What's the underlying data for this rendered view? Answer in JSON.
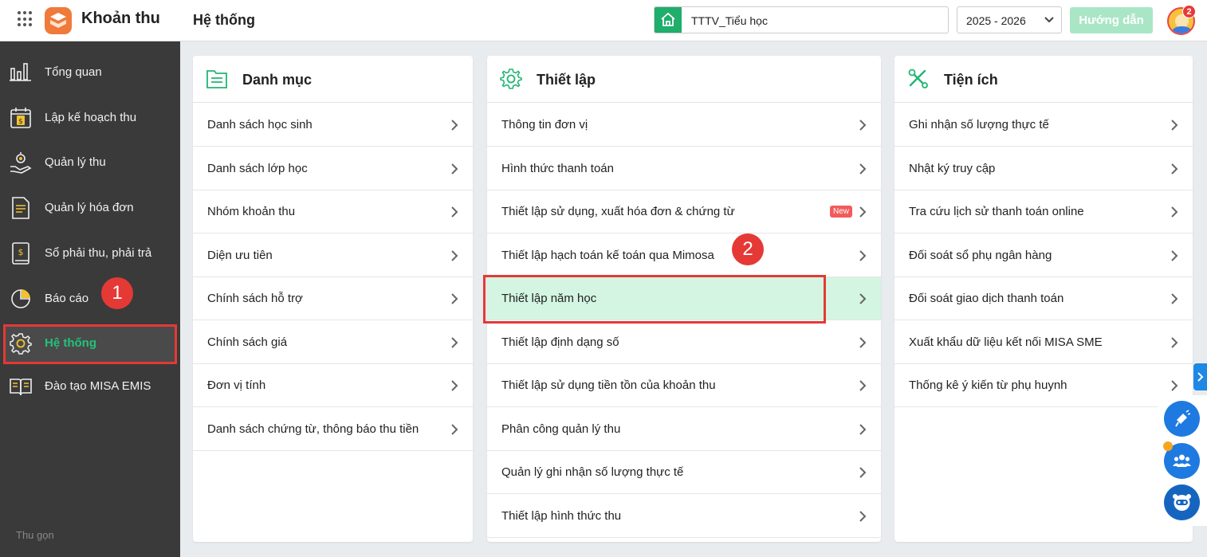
{
  "header": {
    "app_title": "Khoản thu",
    "page_title": "Hệ thống",
    "school": "TTTV_Tiểu học",
    "school_year": "2025 - 2026",
    "guide_label": "Hướng dẫn",
    "notification_count": "2"
  },
  "sidebar": {
    "items": [
      {
        "label": "Tổng quan",
        "icon": "bar-chart-icon"
      },
      {
        "label": "Lập kế hoạch thu",
        "icon": "calendar-dollar-icon"
      },
      {
        "label": "Quản lý thu",
        "icon": "hand-coin-icon"
      },
      {
        "label": "Quản lý hóa đơn",
        "icon": "invoice-icon"
      },
      {
        "label": "Sổ phải thu, phải trả",
        "icon": "ledger-icon"
      },
      {
        "label": "Báo cáo",
        "icon": "pie-chart-icon"
      },
      {
        "label": "Hệ thống",
        "icon": "gear-icon"
      },
      {
        "label": "Đào tạo MISA EMIS",
        "icon": "book-icon"
      }
    ],
    "collapse_label": "Thu gọn"
  },
  "annotations": {
    "step1": "1",
    "step2": "2"
  },
  "panels": {
    "danh_muc": {
      "title": "Danh mục",
      "items": [
        "Danh sách học sinh",
        "Danh sách lớp học",
        "Nhóm khoản thu",
        "Diện ưu tiên",
        "Chính sách hỗ trợ",
        "Chính sách giá",
        "Đơn vị tính",
        "Danh sách chứng từ, thông báo thu tiền"
      ]
    },
    "thiet_lap": {
      "title": "Thiết lập",
      "items": [
        "Thông tin đơn vị",
        "Hình thức thanh toán",
        "Thiết lập sử dụng, xuất hóa đơn & chứng từ",
        "Thiết lập hạch toán kế toán qua Mimosa",
        "Thiết lập năm học",
        "Thiết lập định dạng số",
        "Thiết lập sử dụng tiền tồn của khoản thu",
        "Phân công quản lý thu",
        "Quản lý ghi nhận số lượng thực tế",
        "Thiết lập hình thức thu"
      ],
      "new_badge": "New"
    },
    "tien_ich": {
      "title": "Tiện ích",
      "items": [
        "Ghi nhận số lượng thực tế",
        "Nhật ký truy cập",
        "Tra cứu lịch sử thanh toán online",
        "Đối soát sổ phụ ngân hàng",
        "Đối soát giao dịch thanh toán",
        "Xuất khẩu dữ liệu kết nối MISA SME",
        "Thống kê ý kiến từ phụ huynh"
      ]
    }
  },
  "colors": {
    "accent": "#22c27a",
    "highlight": "#e53935",
    "sidebar_bg": "#3a3a3a"
  }
}
